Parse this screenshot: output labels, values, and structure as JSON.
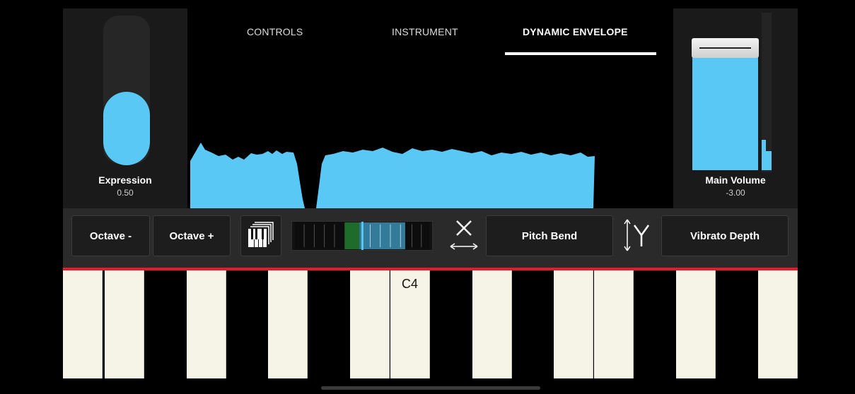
{
  "tabs": [
    {
      "label": "CONTROLS",
      "active": false
    },
    {
      "label": "INSTRUMENT",
      "active": false
    },
    {
      "label": "DYNAMIC ENVELOPE",
      "active": true
    }
  ],
  "expression": {
    "label": "Expression",
    "value": "0.50"
  },
  "main_volume": {
    "label": "Main Volume",
    "value": "-3.00"
  },
  "controls": {
    "octave_down": "Octave -",
    "octave_up": "Octave +",
    "x_axis_target": "Pitch Bend",
    "y_axis_target": "Vibrato Depth"
  },
  "keyboard": {
    "marked_key": "C4"
  },
  "icons": {
    "keyboard_toggle": "piano-keys-icon",
    "x_axis": "x-axis-arrow-icon",
    "y_axis": "y-axis-arrow-icon"
  },
  "colors": {
    "accent": "#5ac8f5",
    "separator": "#e31b2e",
    "key": "#f6f4e6",
    "range_highlight": "#1f6b2a"
  }
}
